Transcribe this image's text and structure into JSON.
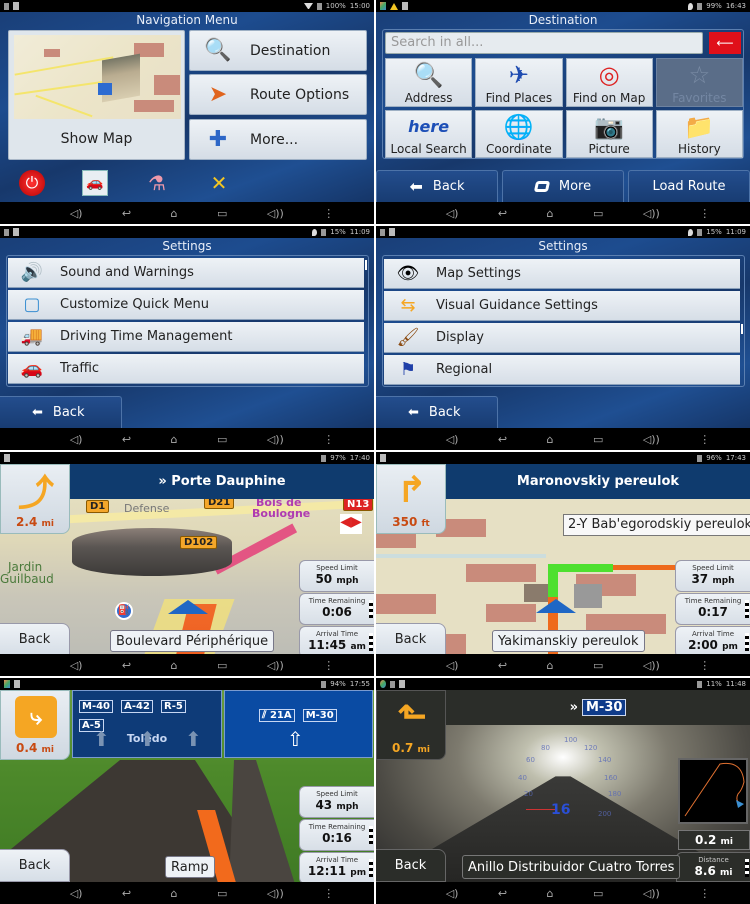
{
  "nav_buttons": {
    "volume_down": "◁)",
    "back": "↩",
    "home": "⌂",
    "recents": "▭",
    "volume_up": "◁))",
    "menu": "⋮"
  },
  "screens": {
    "navigation_menu": {
      "status": {
        "battery": "100%",
        "time": "15:00",
        "icons": [
          "usb-icon",
          "sd-icon",
          "wifi-icon",
          "battery-icon"
        ]
      },
      "title": "Navigation Menu",
      "show_map": "Show Map",
      "buttons": [
        {
          "label": "Destination",
          "icon": "magnifier-icon"
        },
        {
          "label": "Route Options",
          "icon": "route-options-icon"
        },
        {
          "label": "More...",
          "icon": "puzzle-icon"
        }
      ],
      "quick_icons": [
        "power-icon",
        "traffic-icon",
        "flask-icon",
        "tools-icon"
      ]
    },
    "destination": {
      "status": {
        "battery": "99%",
        "time": "16:43"
      },
      "title": "Destination",
      "search_placeholder": "Search in all...",
      "tiles": [
        {
          "label": "Address",
          "icon": "envelope-magnifier-icon",
          "enabled": true
        },
        {
          "label": "Find Places",
          "icon": "places-icon",
          "enabled": true
        },
        {
          "label": "Find on Map",
          "icon": "map-pin-icon",
          "enabled": true
        },
        {
          "label": "Favorites",
          "icon": "star-icon",
          "enabled": false
        },
        {
          "label": "Local Search",
          "icon": "here-icon",
          "enabled": true
        },
        {
          "label": "Coordinate",
          "icon": "globe-icon",
          "enabled": true
        },
        {
          "label": "Picture",
          "icon": "camera-icon",
          "enabled": true
        },
        {
          "label": "History",
          "icon": "folder-clock-icon",
          "enabled": true
        }
      ],
      "back": "Back",
      "more": "More",
      "load_route": "Load Route"
    },
    "settings_1": {
      "status": {
        "battery": "15%",
        "time": "11:09"
      },
      "title": "Settings",
      "items": [
        "Sound and Warnings",
        "Customize Quick Menu",
        "Driving Time Management",
        "Traffic"
      ],
      "back": "Back"
    },
    "settings_2": {
      "status": {
        "battery": "15%",
        "time": "11:09"
      },
      "title": "Settings",
      "items": [
        "Map Settings",
        "Visual Guidance Settings",
        "Display",
        "Regional"
      ],
      "back": "Back"
    },
    "nav_paris": {
      "status": {
        "battery": "97%",
        "time": "17:40"
      },
      "next_street": "» Porte Dauphine",
      "turn_distance": "2.4",
      "turn_unit": "mi",
      "map_labels": {
        "d1": "D1",
        "defense": "Defense",
        "d21": "D21",
        "bois": "Bois de",
        "boulogne": "Boulogne",
        "n13": "N13",
        "d102": "D102",
        "jardin": "Jardin",
        "guilbaud": "Guilbaud"
      },
      "current_street": "Boulevard Périphérique",
      "speed_limit_label": "Speed Limit",
      "speed_limit": "50",
      "speed_unit": "mph",
      "time_remaining_label": "Time Remaining",
      "time_remaining": "0:06",
      "arrival_label": "Arrival Time",
      "arrival_time": "11:45",
      "arrival_ampm": "am",
      "back": "Back"
    },
    "nav_moscow": {
      "status": {
        "battery": "96%",
        "time": "17:43"
      },
      "next_street": "Maronovskiy pereulok",
      "turn_distance": "350",
      "turn_unit": "ft",
      "callout": "2-Y Bab'egorodskiy pereulok",
      "current_street": "Yakimanskiy pereulok",
      "speed_limit_label": "Speed Limit",
      "speed_limit": "37",
      "speed_unit": "mph",
      "time_remaining_label": "Time Remaining",
      "time_remaining": "0:17",
      "arrival_label": "Arrival Time",
      "arrival_time": "2:00",
      "arrival_ampm": "pm",
      "back": "Back"
    },
    "nav_lanes": {
      "status": {
        "battery": "94%",
        "time": "17:55"
      },
      "turn_distance": "0.4",
      "turn_unit": "mi",
      "left_sign": {
        "shields": [
          "M-40",
          "A-42",
          "R-5",
          "A-5"
        ],
        "destination": "Toledo"
      },
      "right_sign": {
        "shields": [
          "21A",
          "M-30"
        ]
      },
      "current_street": "Ramp",
      "speed_limit_label": "Speed Limit",
      "speed_limit": "43",
      "speed_unit": "mph",
      "time_remaining_label": "Time Remaining",
      "time_remaining": "0:16",
      "arrival_label": "Arrival Time",
      "arrival_time": "12:11",
      "arrival_ampm": "pm",
      "back": "Back"
    },
    "nav_tunnel": {
      "status": {
        "battery": "11%",
        "time": "11:48"
      },
      "next_road_prefix": "»",
      "next_road": "M-30",
      "turn_distance": "0.7",
      "turn_unit": "mi",
      "speed": "16",
      "speed_ticks": [
        "20",
        "40",
        "60",
        "80",
        "100",
        "120",
        "140",
        "160",
        "180",
        "200"
      ],
      "minimap_distance": "0.2",
      "minimap_unit": "mi",
      "distance_label": "Distance",
      "distance": "8.6",
      "distance_unit": "mi",
      "current_street": "Anillo Distribuidor Cuatro Torres",
      "back": "Back"
    }
  }
}
